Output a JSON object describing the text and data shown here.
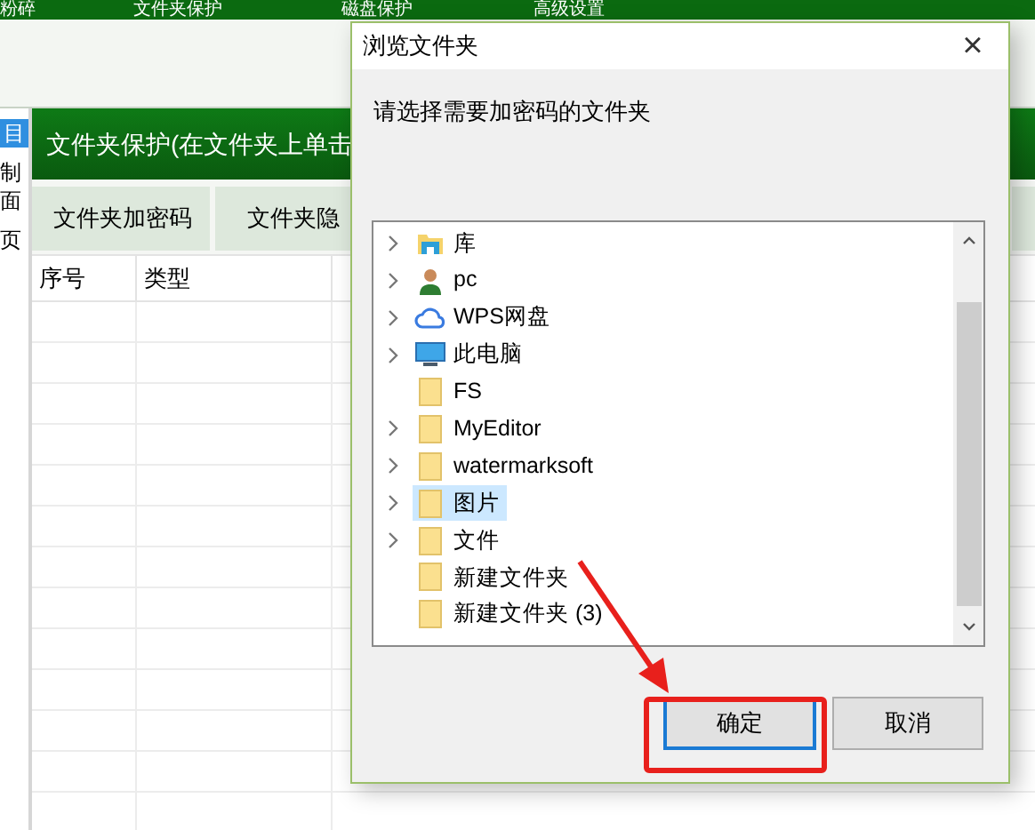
{
  "menu": [
    "粉碎",
    "文件夹保护",
    "磁盘保护",
    "高级设置"
  ],
  "sidebar": [
    {
      "label": "目",
      "selected": true
    },
    {
      "label": "制面",
      "selected": false
    },
    {
      "label": "页",
      "selected": false
    }
  ],
  "panel": {
    "title": "文件夹保护(在文件夹上单击",
    "buttons": [
      "文件夹加密码",
      "文件夹隐"
    ],
    "columns": [
      "序号",
      "类型"
    ]
  },
  "dialog": {
    "title": "浏览文件夹",
    "close": "×",
    "prompt": "请选择需要加密码的文件夹",
    "tree": [
      {
        "label": "库",
        "kind": "library",
        "expandable": true,
        "selected": false
      },
      {
        "label": "pc",
        "kind": "user",
        "expandable": true,
        "selected": false
      },
      {
        "label": "WPS网盘",
        "kind": "cloud",
        "expandable": true,
        "selected": false
      },
      {
        "label": "此电脑",
        "kind": "computer",
        "expandable": true,
        "selected": false
      },
      {
        "label": "FS",
        "kind": "folder",
        "expandable": false,
        "selected": false
      },
      {
        "label": "MyEditor",
        "kind": "folder",
        "expandable": true,
        "selected": false
      },
      {
        "label": "watermarksoft",
        "kind": "folder",
        "expandable": true,
        "selected": false
      },
      {
        "label": "图片",
        "kind": "folder",
        "expandable": true,
        "selected": true
      },
      {
        "label": "文件",
        "kind": "folder",
        "expandable": true,
        "selected": false
      },
      {
        "label": "新建文件夹",
        "kind": "folder",
        "expandable": false,
        "selected": false
      },
      {
        "label": "新建文件夹 (3)",
        "kind": "folder",
        "expandable": false,
        "selected": false
      }
    ],
    "ok": "确定",
    "cancel": "取消"
  }
}
